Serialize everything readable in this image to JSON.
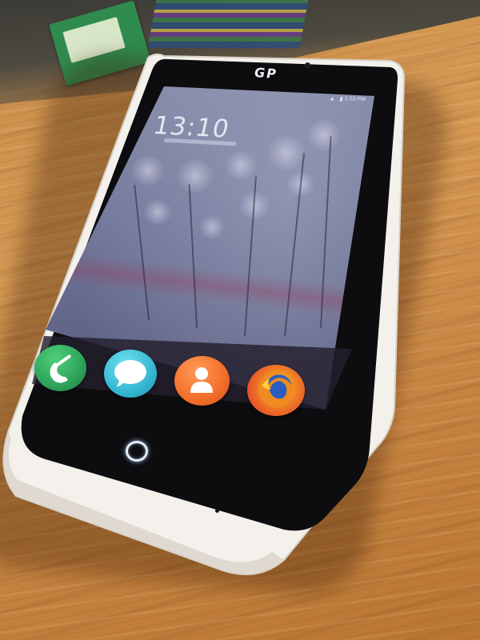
{
  "scene": {
    "description_label": "",
    "surface": "wooden-table"
  },
  "phone": {
    "brand_mark": "GP",
    "body_color": "#f4f1ec",
    "bezel_color": "#0d0d10"
  },
  "lockscreen": {
    "clock": "13:10",
    "clock_suffix": "",
    "status_time": "1:10 PM",
    "status_icons": "▲ ▮"
  },
  "dock": {
    "apps": [
      {
        "name": "Phone",
        "icon": "phone-icon",
        "color": "#2ea35a"
      },
      {
        "name": "Messages",
        "icon": "messages-icon",
        "color": "#35b8d2"
      },
      {
        "name": "Contacts",
        "icon": "contacts-icon",
        "color": "#f26e2a"
      },
      {
        "name": "Firefox",
        "icon": "firefox-icon",
        "color": "#e7562a"
      }
    ]
  },
  "home_button": {
    "icon": "home-ring-icon",
    "glow_color": "#e4efff"
  }
}
